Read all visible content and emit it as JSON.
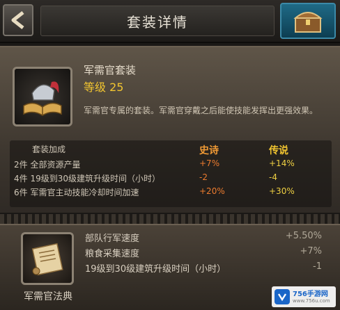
{
  "header": {
    "title": "套装详情",
    "back_icon": "back-arrow-icon",
    "chest_icon": "treasure-chest-icon"
  },
  "set": {
    "name": "军需官套装",
    "level": "等级 25",
    "description": "军需官专属的套装。军需官穿戴之后能使技能发挥出更强效果。",
    "icon": "helmet-and-book-icon"
  },
  "bonus_table": {
    "headers": [
      "套装加成",
      "史诗",
      "传说"
    ],
    "rows": [
      {
        "label": "2件 全部资源产量",
        "epic": "+7%",
        "legendary": "+14%"
      },
      {
        "label": "4件 19级到30级建筑升级时间（小时）",
        "epic": "-2",
        "legendary": "-4"
      },
      {
        "label": "6件 军需官主动技能冷却时间加速",
        "epic": "+20%",
        "legendary": "+30%"
      }
    ]
  },
  "item": {
    "name": "军需官法典",
    "icon": "scroll-icon",
    "attributes": [
      {
        "name": "部队行军速度",
        "value": "+5.50%"
      },
      {
        "name": "粮食采集速度",
        "value": "+7%"
      },
      {
        "name": "19级到30级建筑升级时间（小时）",
        "value": "-1"
      }
    ]
  },
  "watermark": {
    "brand": "756手游网",
    "url": "www.756u.com"
  },
  "colors": {
    "level": "#f2c530",
    "epic": "#ec7b2e",
    "legendary": "#eecf42",
    "chest_btn": "#1f6a86"
  }
}
